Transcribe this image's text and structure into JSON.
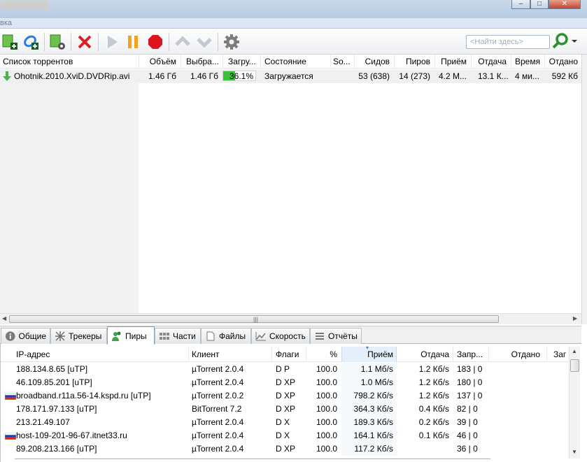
{
  "window": {
    "menu_text": "вка",
    "minimize_glyph": "–",
    "maximize_glyph": "□",
    "close_glyph": "✕"
  },
  "toolbar": {
    "buttons": [
      "add-torrent-icon",
      "add-url-icon",
      "create-torrent-icon",
      "remove-icon",
      "start-icon",
      "pause-icon",
      "stop-icon",
      "move-up-icon",
      "move-down-icon",
      "settings-icon"
    ],
    "search_placeholder": "<Найти здесь>"
  },
  "torrent_list": {
    "columns": [
      "Список торрентов",
      "Объём",
      "Выбра...",
      "Загру...",
      "Состояние",
      "So...",
      "Сидов",
      "Пиров",
      "Приём",
      "Отдача",
      "Время",
      "Отдано"
    ],
    "rows": [
      {
        "name": "Ohotnik.2010.XviD.DVDRip.avi",
        "size": "1.46 Гб",
        "selected": "1.46 Гб",
        "progress_text": "36.1%",
        "progress": 0.361,
        "status": "Загружается",
        "seeds": "53 (638)",
        "peers": "14 (273)",
        "down": "4.2 М...",
        "up": "13.1 К...",
        "eta": "4 ми...",
        "uploaded": "592 Кб"
      }
    ],
    "hscroll_grip": "|||"
  },
  "tabs": [
    {
      "label": "Общие",
      "icon": "info-icon",
      "active": false
    },
    {
      "label": "Трекеры",
      "icon": "trackers-icon",
      "active": false
    },
    {
      "label": "Пиры",
      "icon": "peers-icon",
      "active": true
    },
    {
      "label": "Части",
      "icon": "pieces-icon",
      "active": false
    },
    {
      "label": "Файлы",
      "icon": "files-icon",
      "active": false
    },
    {
      "label": "Скорость",
      "icon": "speed-icon",
      "active": false
    },
    {
      "label": "Отчёты",
      "icon": "log-icon",
      "active": false
    }
  ],
  "peers": {
    "columns": [
      "IP-адрес",
      "Клиент",
      "Флаги",
      "%",
      "Приём",
      "Отдача",
      "Запр...",
      "Отдано",
      "Заг"
    ],
    "sort_indicator": "▾",
    "rows": [
      {
        "ip": "188.134.8.65 [uTP]",
        "client": "µTorrent 2.0.4",
        "flags": "D P",
        "pct": "100.0",
        "down": "1.1 Мб/s",
        "up": "1.2 Кб/s",
        "req": "183 | 0",
        "flag": false
      },
      {
        "ip": "46.109.85.201 [uTP]",
        "client": "µTorrent 2.0.4",
        "flags": "D XP",
        "pct": "100.0",
        "down": "1.0 Мб/s",
        "up": "1.2 Кб/s",
        "req": "180 | 0",
        "flag": false
      },
      {
        "ip": "broadband.r11a.56-14.kspd.ru [uTP]",
        "client": "µTorrent 2.0.2",
        "flags": "D XP",
        "pct": "100.0",
        "down": "798.2 Кб/s",
        "up": "1.2 Кб/s",
        "req": "137 | 0",
        "flag": true
      },
      {
        "ip": "178.171.97.133 [uTP]",
        "client": "BitTorrent 7.2",
        "flags": "D XP",
        "pct": "100.0",
        "down": "364.3 Кб/s",
        "up": "0.4 Кб/s",
        "req": "82 | 0",
        "flag": false
      },
      {
        "ip": "213.21.49.107",
        "client": "µTorrent 2.0.4",
        "flags": "D X",
        "pct": "100.0",
        "down": "189.3 Кб/s",
        "up": "0.2 Кб/s",
        "req": "39 | 0",
        "flag": false
      },
      {
        "ip": "host-109-201-96-67.itnet33.ru",
        "client": "µTorrent 2.0.4",
        "flags": "D X",
        "pct": "100.0",
        "down": "164.1 Кб/s",
        "up": "0.1 Кб/s",
        "req": "46 | 0",
        "flag": true
      },
      {
        "ip": "89.208.213.166 [uTP]",
        "client": "µTorrent 2.0.4",
        "flags": "D XP",
        "pct": "100.0",
        "down": "117.2 Кб/s",
        "up": "",
        "req": "36 | 0",
        "flag": false
      }
    ]
  },
  "colors": {
    "progress_fill": "#3cc13c",
    "remove_red": "#e02020",
    "pause_orange": "#f3a21b",
    "stop_red": "#e0141e",
    "search_green": "#2f8f2f"
  }
}
